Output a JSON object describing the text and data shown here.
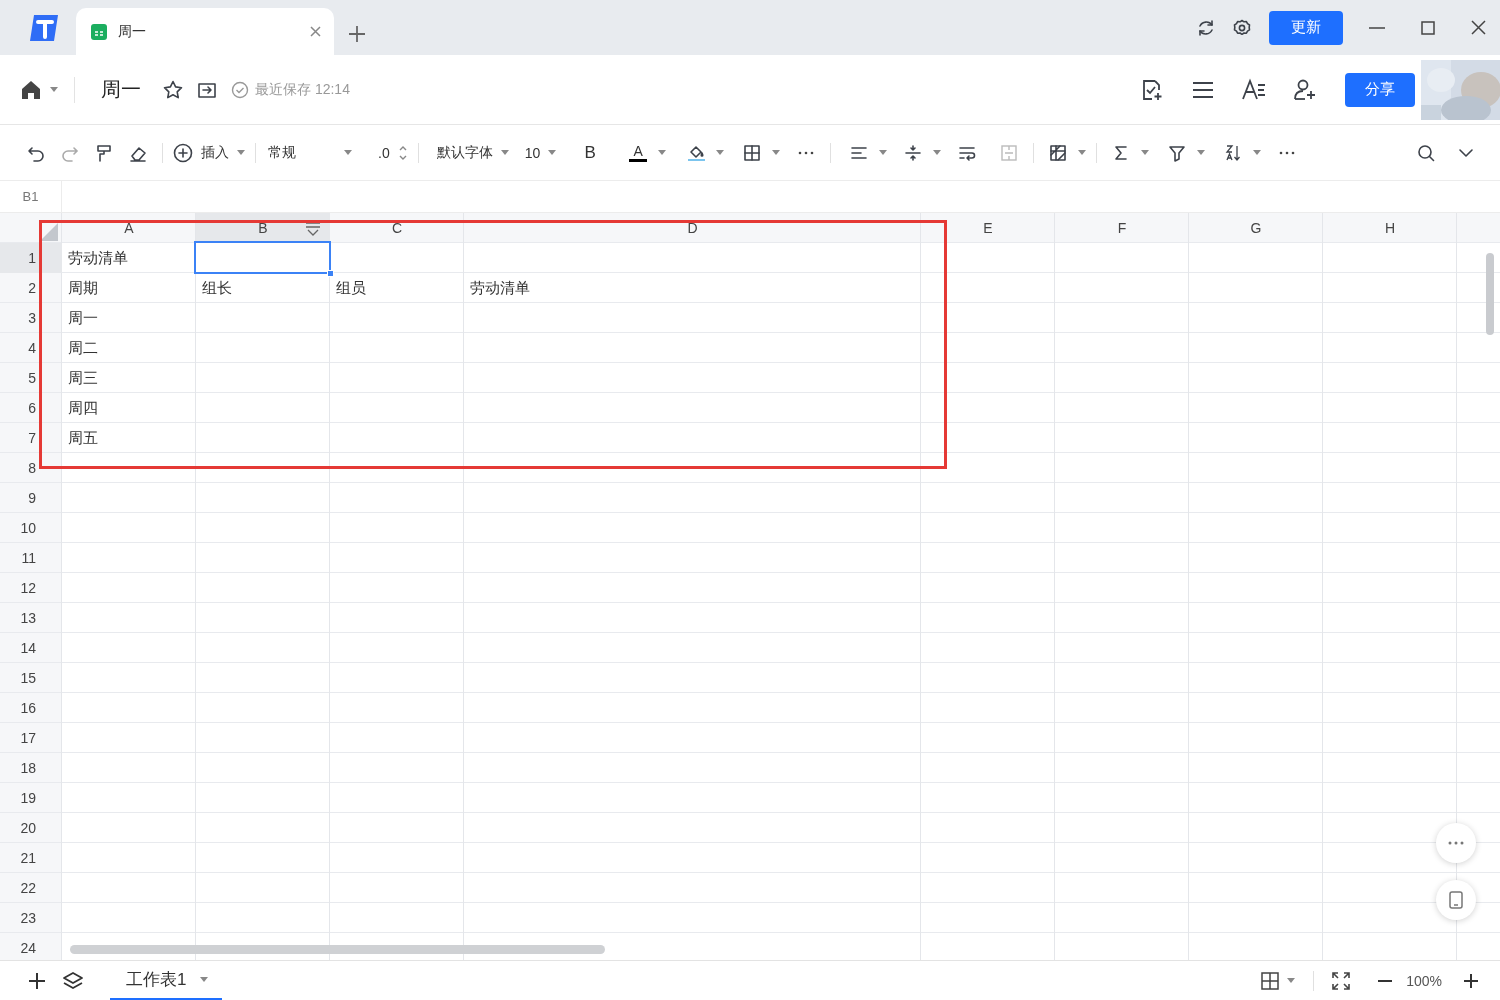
{
  "window": {
    "tabs": [
      {
        "title": "周一",
        "selected": true
      }
    ],
    "update_button": "更新"
  },
  "doc_header": {
    "title": "周一",
    "save_status": "最近保存 12:14",
    "share_button": "分享"
  },
  "toolbar": {
    "insert": "插入",
    "number_format": "常规",
    "decimal": ".0",
    "font": "默认字体",
    "font_size": "10",
    "bold": "B",
    "text_color": "A"
  },
  "formula_bar": {
    "cell_ref": "B1"
  },
  "sheet": {
    "columns": [
      {
        "label": "A",
        "selected": false
      },
      {
        "label": "B",
        "selected": true
      },
      {
        "label": "C",
        "selected": false
      },
      {
        "label": "D",
        "selected": false
      },
      {
        "label": "E",
        "selected": false
      },
      {
        "label": "F",
        "selected": false
      },
      {
        "label": "G",
        "selected": false
      },
      {
        "label": "H",
        "selected": false
      }
    ],
    "rows": [
      {
        "number": "1",
        "selected": true,
        "cells": [
          "劳动清单"
        ]
      },
      {
        "number": "2",
        "selected": false,
        "cells": [
          "周期",
          "组长",
          "组员",
          "劳动清单"
        ]
      },
      {
        "number": "3",
        "selected": false,
        "cells": [
          "周一"
        ]
      },
      {
        "number": "4",
        "selected": false,
        "cells": [
          "周二"
        ]
      },
      {
        "number": "5",
        "selected": false,
        "cells": [
          "周三"
        ]
      },
      {
        "number": "6",
        "selected": false,
        "cells": [
          "周四"
        ]
      },
      {
        "number": "7",
        "selected": false,
        "cells": [
          "周五"
        ]
      },
      {
        "number": "8",
        "selected": false
      },
      {
        "number": "9",
        "selected": false
      },
      {
        "number": "10",
        "selected": false
      },
      {
        "number": "11",
        "selected": false
      },
      {
        "number": "12",
        "selected": false
      },
      {
        "number": "13",
        "selected": false
      },
      {
        "number": "14",
        "selected": false
      },
      {
        "number": "15",
        "selected": false
      },
      {
        "number": "16",
        "selected": false
      },
      {
        "number": "17",
        "selected": false
      },
      {
        "number": "18",
        "selected": false
      },
      {
        "number": "19",
        "selected": false
      },
      {
        "number": "20",
        "selected": false
      },
      {
        "number": "21",
        "selected": false
      },
      {
        "number": "22",
        "selected": false
      },
      {
        "number": "23",
        "selected": false
      },
      {
        "number": "24",
        "selected": false
      }
    ]
  },
  "annotations": [
    {
      "kind": "highlight-box"
    }
  ],
  "sheet_tabs": [
    {
      "label": "工作表1",
      "selected": true
    }
  ],
  "status_bar": {
    "zoom": "100%"
  }
}
